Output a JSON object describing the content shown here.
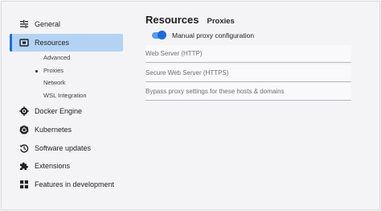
{
  "sidebar": {
    "items": [
      {
        "label": "General",
        "icon": "sliders-icon"
      },
      {
        "label": "Resources",
        "icon": "resources-icon",
        "active": true
      },
      {
        "label": "Docker Engine",
        "icon": "docker-engine-icon"
      },
      {
        "label": "Kubernetes",
        "icon": "kubernetes-icon"
      },
      {
        "label": "Software updates",
        "icon": "history-icon"
      },
      {
        "label": "Extensions",
        "icon": "puzzle-icon"
      },
      {
        "label": "Features in development",
        "icon": "grid-icon"
      }
    ],
    "subitems": [
      {
        "label": "Advanced"
      },
      {
        "label": "Proxies",
        "active": true
      },
      {
        "label": "Network"
      },
      {
        "label": "WSL Integration"
      }
    ]
  },
  "main": {
    "title": "Resources",
    "subtitle": "Proxies",
    "toggle_label": "Manual proxy configuration",
    "toggle_on": true,
    "fields": {
      "http_placeholder": "Web Server (HTTP)",
      "https_placeholder": "Secure Web Server (HTTPS)",
      "bypass_placeholder": "Bypass proxy settings for these hosts & domains"
    }
  },
  "colors": {
    "accent": "#1f6fd1",
    "active_bg": "#b4d3f4",
    "toggle_track": "#5d9ce8"
  }
}
